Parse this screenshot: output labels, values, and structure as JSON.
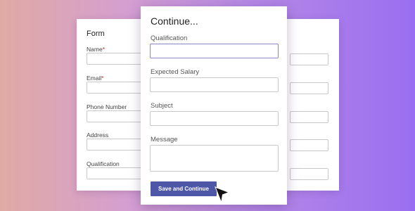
{
  "left_form": {
    "title": "Form",
    "fields": [
      {
        "label": "Name",
        "required": "*"
      },
      {
        "label": "Email",
        "required": "*"
      },
      {
        "label": "Phone Number",
        "required": ""
      },
      {
        "label": "Address",
        "required": ""
      },
      {
        "label": "Qualification",
        "required": ""
      }
    ]
  },
  "main_form": {
    "title": "Continue...",
    "fields": [
      {
        "label": "Qualification",
        "value": ""
      },
      {
        "label": "Expected Salary",
        "value": ""
      },
      {
        "label": "Subject",
        "value": ""
      },
      {
        "label": "Message",
        "value": ""
      }
    ],
    "submit_label": "Save and Continue"
  },
  "colors": {
    "button": "#4e56a8",
    "focus_border": "#8a86c8",
    "required_mark": "#c0272d"
  },
  "icons": {
    "cursor": "mouse-pointer-icon"
  }
}
